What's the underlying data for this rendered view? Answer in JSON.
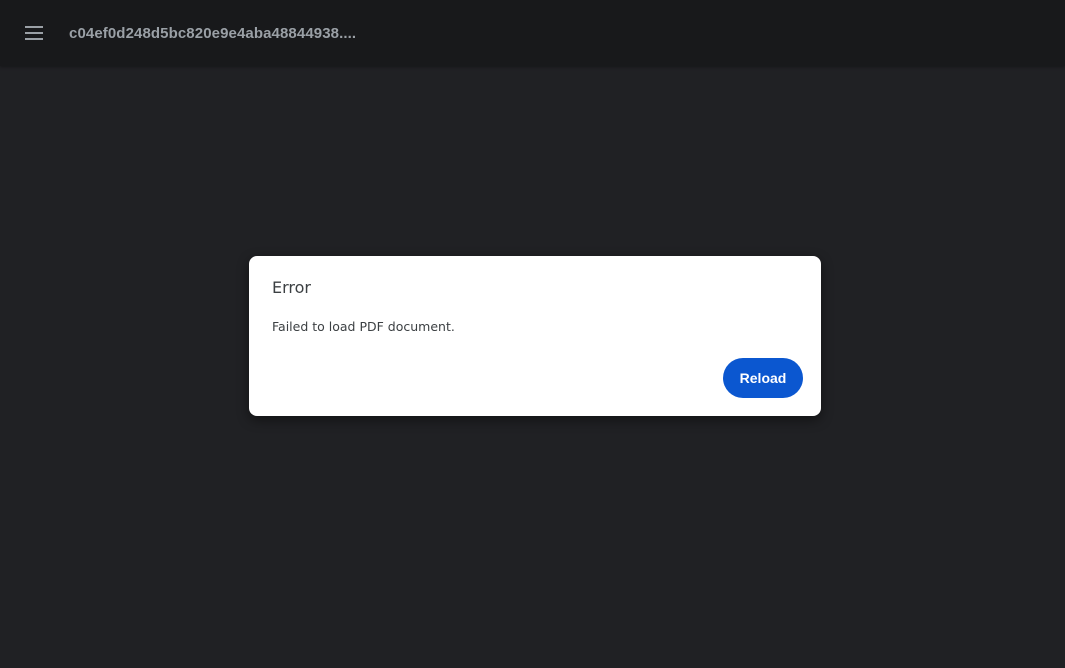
{
  "toolbar": {
    "menu_icon": "hamburger-menu-icon",
    "title": "c04ef0d248d5bc820e9e4aba48844938...."
  },
  "dialog": {
    "title": "Error",
    "message": "Failed to load PDF document.",
    "reload_label": "Reload"
  },
  "colors": {
    "background": "#202124",
    "toolbar": "#18191b",
    "dialog_bg": "#ffffff",
    "accent": "#0b57d0",
    "title_text": "#9aa0a6"
  }
}
